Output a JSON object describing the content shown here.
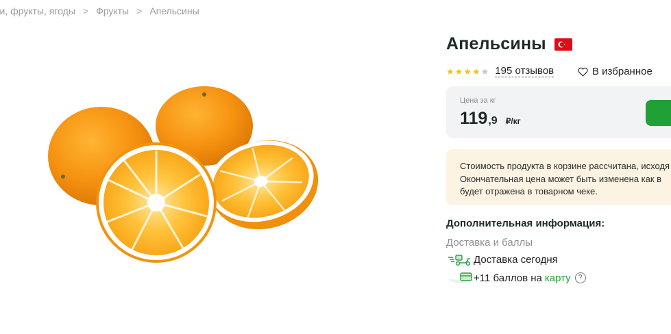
{
  "breadcrumb": {
    "items": [
      "Овощи, фрукты, ягоды",
      "Фрукты",
      "Апельсины"
    ],
    "visible_first": "щи, фрукты, ягоды"
  },
  "product": {
    "title": "Апельсины",
    "country_flag_icon": "turkey-flag-icon",
    "rating": 4,
    "rating_max": 5,
    "reviews_label": "195 отзывов",
    "favorite_label": "В избранное"
  },
  "price": {
    "label": "Цена за кг",
    "integer": "119",
    "fraction": ",9",
    "unit": "₽/кг"
  },
  "notice": {
    "line1": "Стоимость продукта в корзине рассчитана, исходя",
    "line2": "Окончательная цена может быть изменена как в",
    "line3": "будет отражена в товарном чеке."
  },
  "additional": {
    "title": "Дополнительная информация:",
    "delivery_heading": "Доставка и баллы",
    "delivery_label": "Доставка сегодня",
    "points_prefix": "+11 баллов на",
    "points_link": "карту",
    "help_symbol": "?"
  },
  "colors": {
    "accent_green": "#21a038",
    "star_yellow": "#f5c400",
    "notice_bg": "#fdf3e3",
    "price_bg": "#f2f3f5"
  }
}
